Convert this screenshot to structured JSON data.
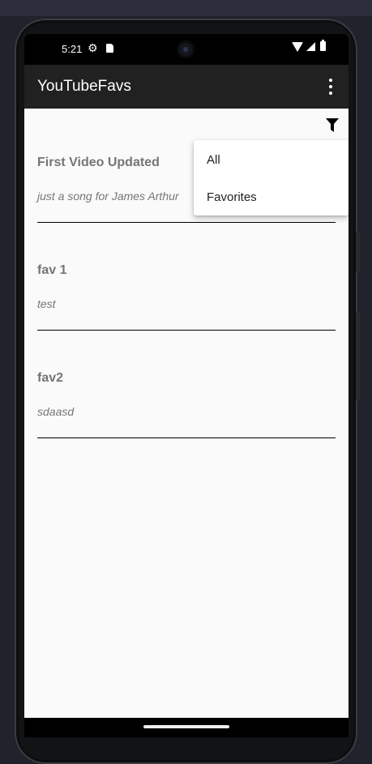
{
  "status_bar": {
    "time": "5:21",
    "icons": [
      "settings-gear-icon",
      "sd-card-icon",
      "wifi-icon",
      "cell-signal-icon",
      "battery-icon"
    ]
  },
  "app_bar": {
    "title": "YouTubeFavs",
    "menu_icon": "more-vert-icon"
  },
  "toolbar": {
    "filter_icon": "filter-icon"
  },
  "videos": [
    {
      "title": "First Video Updated",
      "description": "just a song for James Arthur"
    },
    {
      "title": "fav 1",
      "description": "test"
    },
    {
      "title": "fav2",
      "description": "sdaasd"
    }
  ],
  "filter_menu": {
    "items": [
      "All",
      "Favorites"
    ]
  },
  "colors": {
    "app_bar": "#212121",
    "background": "#fafafa",
    "text_secondary": "#757575"
  }
}
